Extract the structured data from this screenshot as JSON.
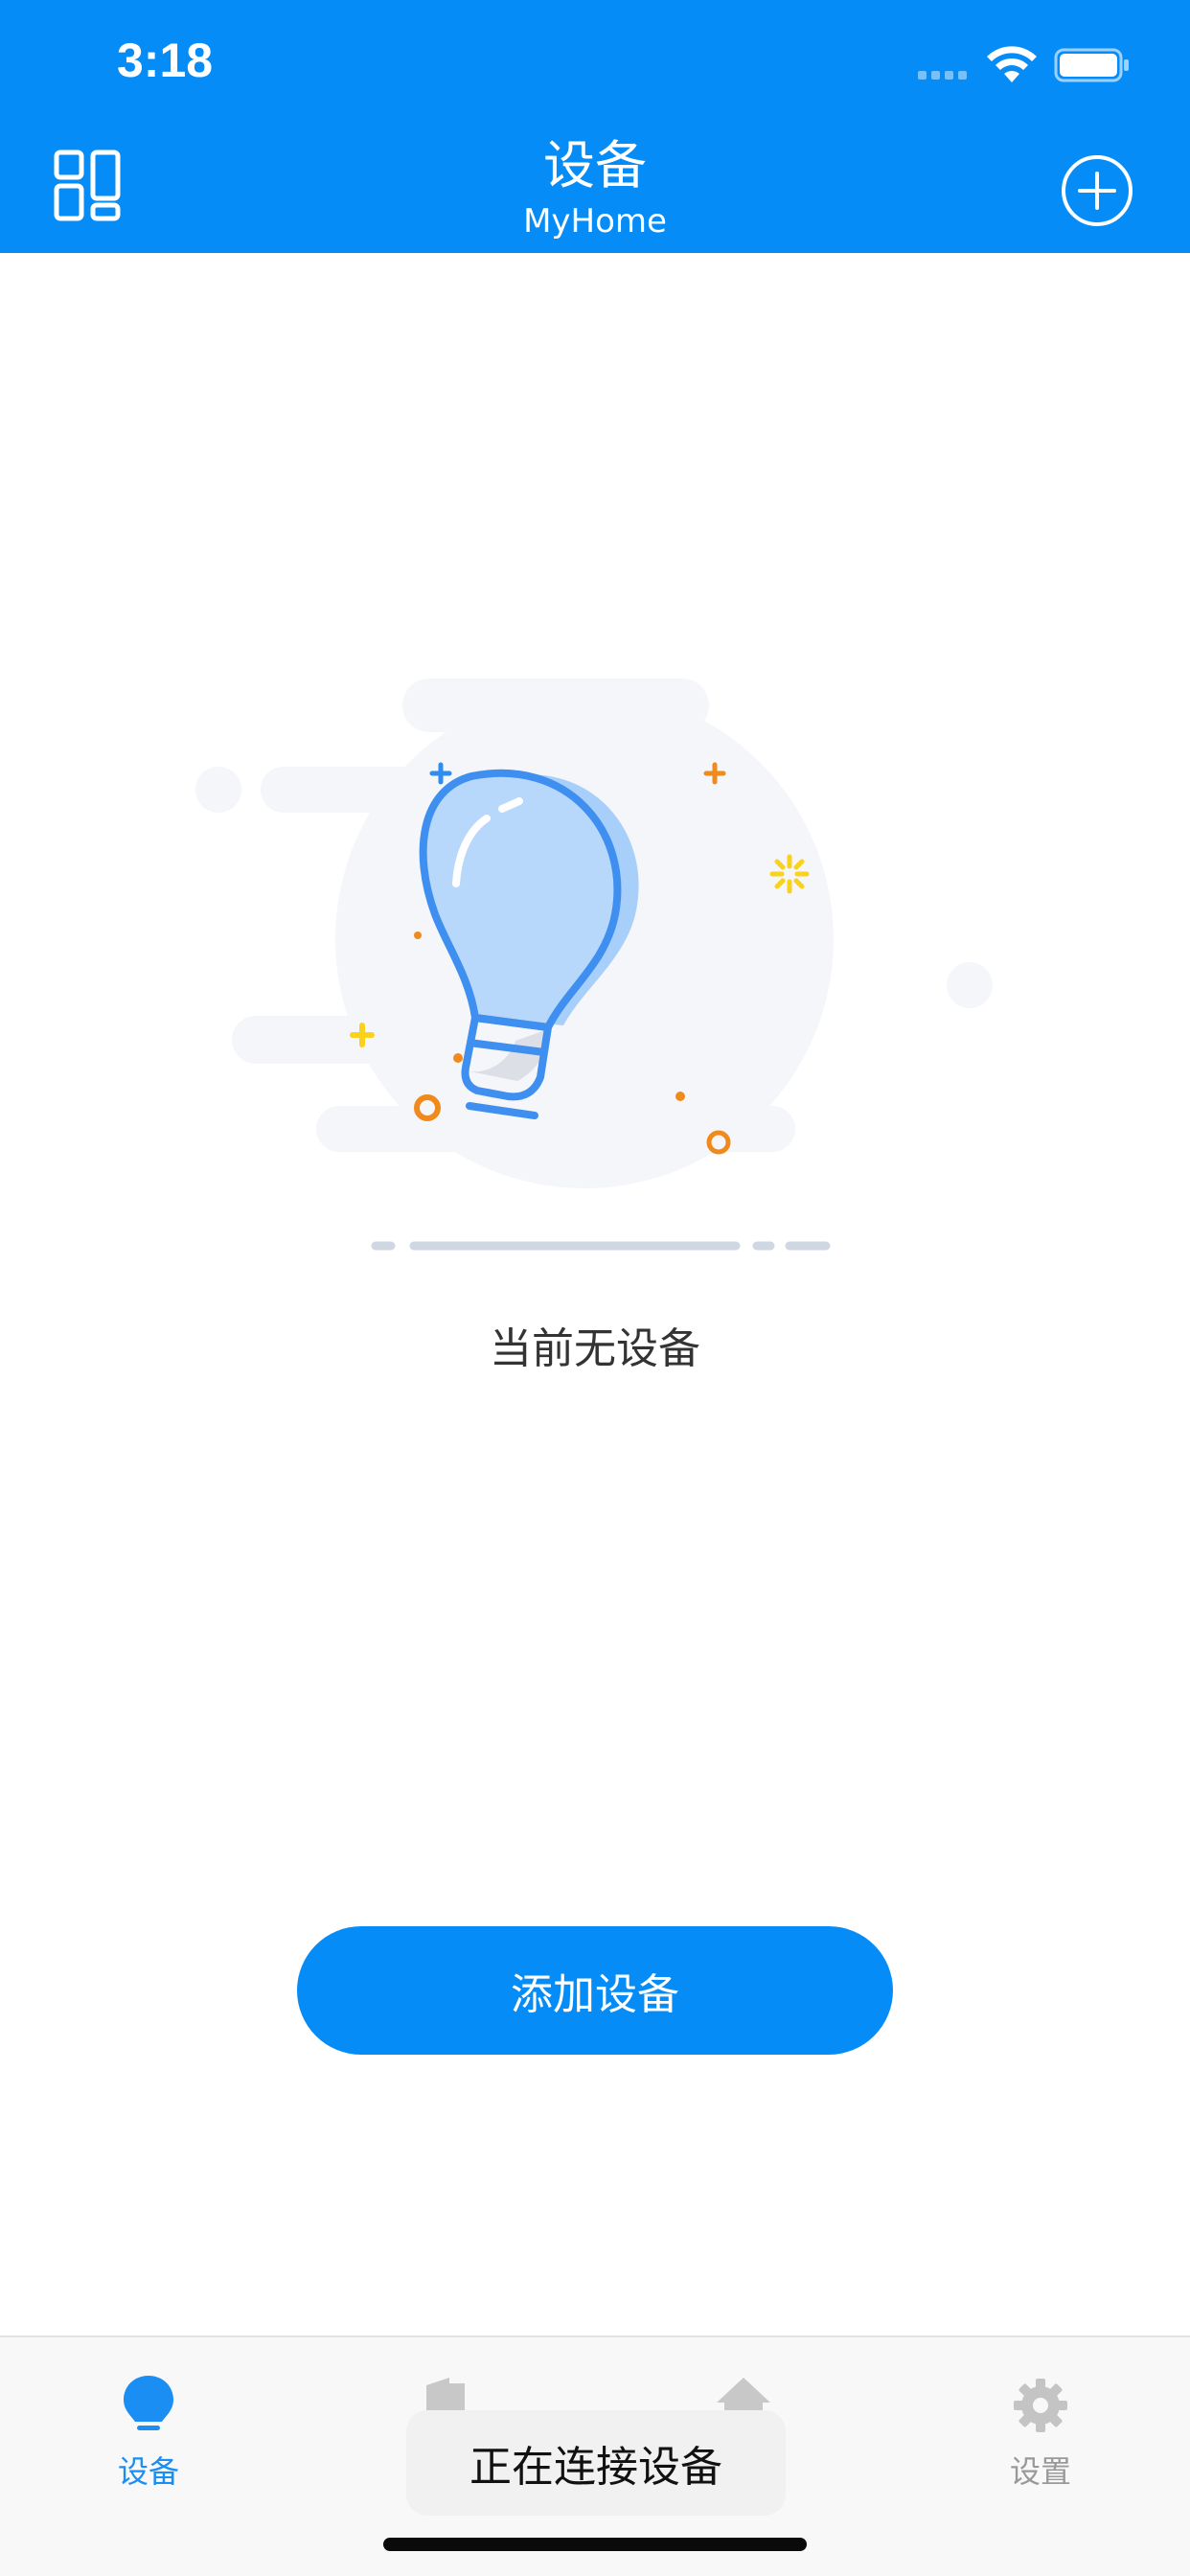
{
  "status_bar": {
    "time": "3:18"
  },
  "header": {
    "title": "设备",
    "subtitle": "MyHome"
  },
  "empty_state": {
    "message": "当前无设备"
  },
  "add_device_button": {
    "label": "添加设备"
  },
  "tabbar": {
    "tabs": [
      {
        "label": "设备",
        "icon": "bulb-icon",
        "active": true
      },
      {
        "label": "",
        "icon": "door-icon",
        "active": false
      },
      {
        "label": "",
        "icon": "home-icon",
        "active": false
      },
      {
        "label": "设置",
        "icon": "gear-icon",
        "active": false
      }
    ]
  },
  "toast": {
    "message": "正在连接设备"
  },
  "colors": {
    "accent": "#068cf7",
    "tab_active": "#1a8ef2",
    "tab_inactive": "#999999"
  }
}
